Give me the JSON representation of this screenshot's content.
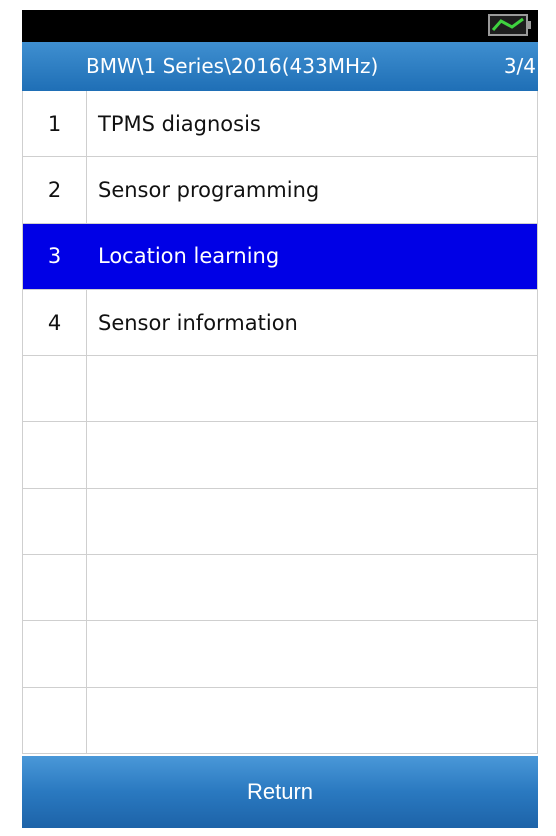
{
  "header": {
    "title": "BMW\\1 Series\\2016(433MHz)",
    "page_indicator": "3/4"
  },
  "menu": {
    "selected_index": 2,
    "items": [
      {
        "num": "1",
        "label": "TPMS diagnosis"
      },
      {
        "num": "2",
        "label": "Sensor programming"
      },
      {
        "num": "3",
        "label": "Location learning"
      },
      {
        "num": "4",
        "label": "Sensor information"
      }
    ],
    "empty_rows": 6
  },
  "footer": {
    "return_label": "Return"
  },
  "colors": {
    "selected_row": "#0000e6",
    "header": "#2f7fc4"
  },
  "icons": {
    "battery": "battery-icon"
  }
}
